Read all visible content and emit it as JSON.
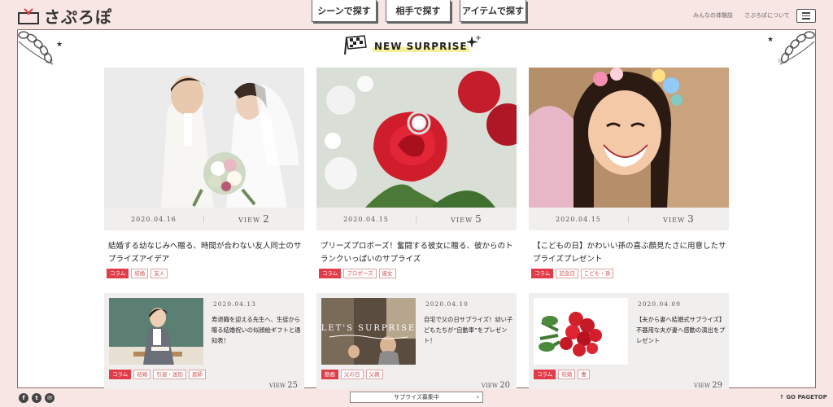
{
  "header": {
    "logo_text": "さぷろぽ",
    "nav": [
      "シーンで探す",
      "相手で探す",
      "アイテムで探す"
    ],
    "links": [
      "みんなの体験談",
      "さぷろぽについて"
    ]
  },
  "section_title": "NEW SURPRISE",
  "cards": [
    {
      "date": "2020.04.16",
      "view_label": "VIEW",
      "view_count": "2",
      "title": "結婚する幼なじみへ贈る、時間が合わない友人同士のサプライズアイデア",
      "tags": [
        "コラム",
        "結婚",
        "友人"
      ]
    },
    {
      "date": "2020.04.15",
      "view_label": "VIEW",
      "view_count": "5",
      "title": "プリーズプロポーズ！奮闘する彼女に贈る、彼からのトランクいっぱいのサプライズ",
      "tags": [
        "コラム",
        "プロポーズ",
        "彼女"
      ]
    },
    {
      "date": "2020.04.15",
      "view_label": "VIEW",
      "view_count": "3",
      "title": "【こどもの日】かわいい孫の喜ぶ顔見たさに用意したサプライズプレゼント",
      "tags": [
        "コラム",
        "記念日",
        "こども・孫"
      ]
    }
  ],
  "small_cards": [
    {
      "date": "2020.04.13",
      "title": "寿退職を迎える先生へ、生徒から贈る結婚祝いの似顔絵ギフトと通知表！",
      "tags": [
        "コラム",
        "結婚",
        "引退・送別",
        "恩師"
      ],
      "view_label": "VIEW",
      "view_count": "25"
    },
    {
      "date": "2020.04.10",
      "title": "自宅で父の日サプライズ！幼い子どもたちが“自動車”をプレゼント！",
      "tags": [
        "動画",
        "父の日",
        "父親"
      ],
      "view_label": "VIEW",
      "view_count": "20",
      "image_text": "LET'S SURPRISE"
    },
    {
      "date": "2020.04.09",
      "title": "【夫から妻へ結婚式サプライズ】不器用な夫が妻へ感動の演出をプレゼント",
      "tags": [
        "コラム",
        "結婚",
        "妻"
      ],
      "view_label": "VIEW",
      "view_count": "29"
    }
  ],
  "footer": {
    "social": [
      "f",
      "t",
      "✉"
    ],
    "recruit": "サプライズ募集中",
    "pagetop": "GO PAGETOP"
  },
  "colors": {
    "accent": "#e03c4a",
    "background": "#f7e6e4",
    "highlight": "#f7f09a"
  }
}
